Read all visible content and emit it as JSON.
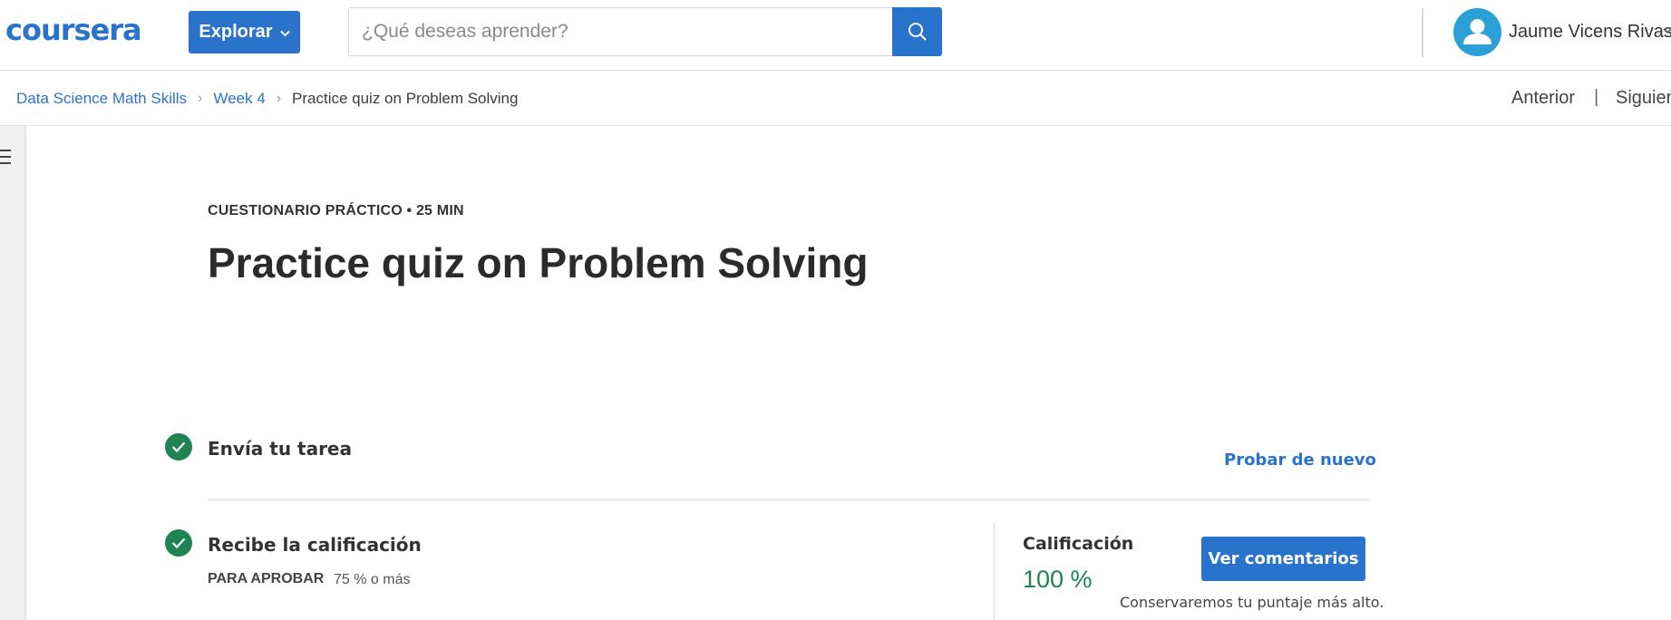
{
  "header": {
    "logo_text": "coursera",
    "explore_label": "Explorar",
    "search_placeholder": "¿Qué deseas aprender?",
    "user_name": "Jaume Vicens Rivas",
    "icons": [
      "chevron-down-icon",
      "search-icon",
      "user-avatar-icon"
    ]
  },
  "breadcrumb": {
    "items": [
      {
        "label": "Data Science Math Skills"
      },
      {
        "label": "Week 4"
      },
      {
        "label": "Practice quiz on Problem Solving"
      }
    ],
    "prev_label": "Anterior",
    "separator": "|",
    "next_label": "Siguien"
  },
  "quiz": {
    "kicker": "CUESTIONARIO PRÁCTICO • 25 MIN",
    "title": "Practice quiz on Problem Solving"
  },
  "steps": {
    "submit": {
      "label": "Envía tu tarea",
      "retry_label": "Probar de nuevo"
    },
    "grade": {
      "label": "Recibe la calificación",
      "pass_label": "PARA APROBAR",
      "pass_value": "75 % o más",
      "grade_label": "Calificación",
      "grade_value": "100 %",
      "feedback_label": "Ver comentarios",
      "keep_note": "Conservaremos tu puntaje más alto."
    }
  },
  "colors": {
    "brand_blue": "#2a73cc",
    "success_green": "#1f8354",
    "avatar_blue": "#2a9fd8"
  }
}
